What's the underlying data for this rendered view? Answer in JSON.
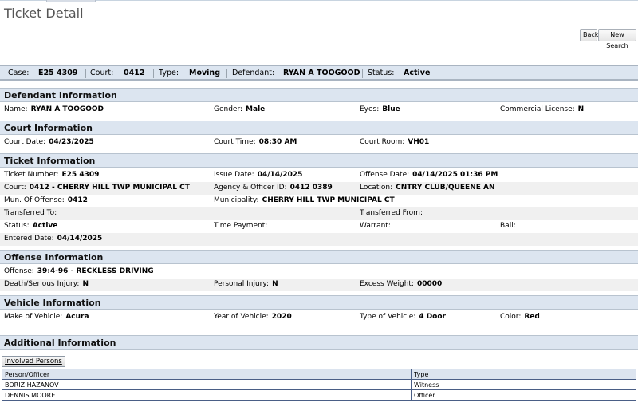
{
  "page": {
    "title": "Ticket Detail"
  },
  "toolbar": {
    "back_label": "Back",
    "new_search_label": "New Search"
  },
  "summary": {
    "case_label": "Case:",
    "case_value": "E25 4309",
    "court_label": "Court:",
    "court_value": "0412",
    "type_label": "Type:",
    "type_value": "Moving",
    "defendant_label": "Defendant:",
    "defendant_value": "RYAN A TOOGOOD",
    "status_label": "Status:",
    "status_value": "Active"
  },
  "defendant": {
    "heading": "Defendant Information",
    "name_label": "Name:",
    "name_value": "RYAN A TOOGOOD",
    "gender_label": "Gender:",
    "gender_value": "Male",
    "eyes_label": "Eyes:",
    "eyes_value": "Blue",
    "commercial_label": "Commercial License:",
    "commercial_value": "N"
  },
  "court": {
    "heading": "Court Information",
    "date_label": "Court Date:",
    "date_value": "04/23/2025",
    "time_label": "Court Time:",
    "time_value": "08:30 AM",
    "room_label": "Court Room:",
    "room_value": "VH01"
  },
  "ticket": {
    "heading": "Ticket Information",
    "number_label": "Ticket Number:",
    "number_value": "E25 4309",
    "issue_label": "Issue Date:",
    "issue_value": "04/14/2025",
    "offense_date_label": "Offense Date:",
    "offense_date_value": "04/14/2025 01:36 PM",
    "court_label": "Court:",
    "court_value": "0412 - CHERRY HILL TWP MUNICIPAL CT",
    "agency_label": "Agency & Officer ID:",
    "agency_value": "0412 0389",
    "location_label": "Location:",
    "location_value": "CNTRY CLUB/QUEENE AN",
    "mun_label": "Mun. Of Offense:",
    "mun_value": "0412",
    "municipality_label": "Municipality:",
    "municipality_value": "CHERRY HILL TWP MUNICIPAL CT",
    "transferred_to_label": "Transferred To:",
    "transferred_from_label": "Transferred From:",
    "status_label": "Status:",
    "status_value": "Active",
    "time_payment_label": "Time Payment:",
    "warrant_label": "Warrant:",
    "bail_label": "Bail:",
    "entered_label": "Entered Date:",
    "entered_value": "04/14/2025"
  },
  "offense": {
    "heading": "Offense Information",
    "offense_label": "Offense:",
    "offense_value": "39:4-96 - RECKLESS DRIVING",
    "death_label": "Death/Serious Injury:",
    "death_value": "N",
    "personal_label": "Personal Injury:",
    "personal_value": "N",
    "weight_label": "Excess Weight:",
    "weight_value": "00000"
  },
  "vehicle": {
    "heading": "Vehicle Information",
    "make_label": "Make of Vehicle:",
    "make_value": "Acura",
    "year_label": "Year of Vehicle:",
    "year_value": "2020",
    "type_label": "Type of Vehicle:",
    "type_value": "4 Door",
    "color_label": "Color:",
    "color_value": "Red"
  },
  "additional": {
    "heading": "Additional Information",
    "involved_button": "Involved Persons",
    "columns": [
      "Person/Officer",
      "Type"
    ],
    "rows": [
      {
        "person": "BORIZ HAZANOV",
        "type": "Witness"
      },
      {
        "person": "DENNIS MOORE",
        "type": "Officer"
      }
    ]
  }
}
